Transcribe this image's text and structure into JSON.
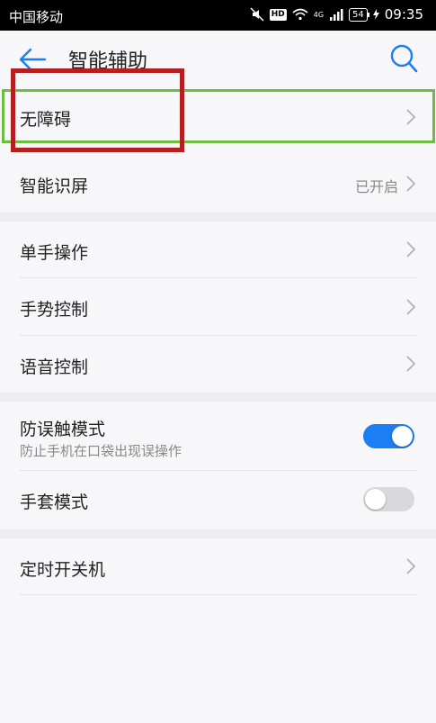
{
  "status_bar": {
    "carrier": "中国移动",
    "network": "4G",
    "battery": "54",
    "time": "09:35"
  },
  "header": {
    "title": "智能辅助"
  },
  "rows": {
    "accessibility": {
      "label": "无障碍"
    },
    "smart_screen": {
      "label": "智能识屏",
      "value": "已开启"
    },
    "one_hand": {
      "label": "单手操作"
    },
    "gesture": {
      "label": "手势控制"
    },
    "voice": {
      "label": "语音控制"
    },
    "accidental_touch": {
      "label": "防误触模式",
      "subtitle": "防止手机在口袋出现误操作",
      "enabled": true
    },
    "glove": {
      "label": "手套模式",
      "enabled": false
    },
    "scheduled_power": {
      "label": "定时开关机"
    }
  },
  "colors": {
    "accent": "#1b7ef2",
    "toggle_off": "#d9d9dd",
    "highlight_red": "#b3201f",
    "highlight_green": "#6cbf3e"
  }
}
